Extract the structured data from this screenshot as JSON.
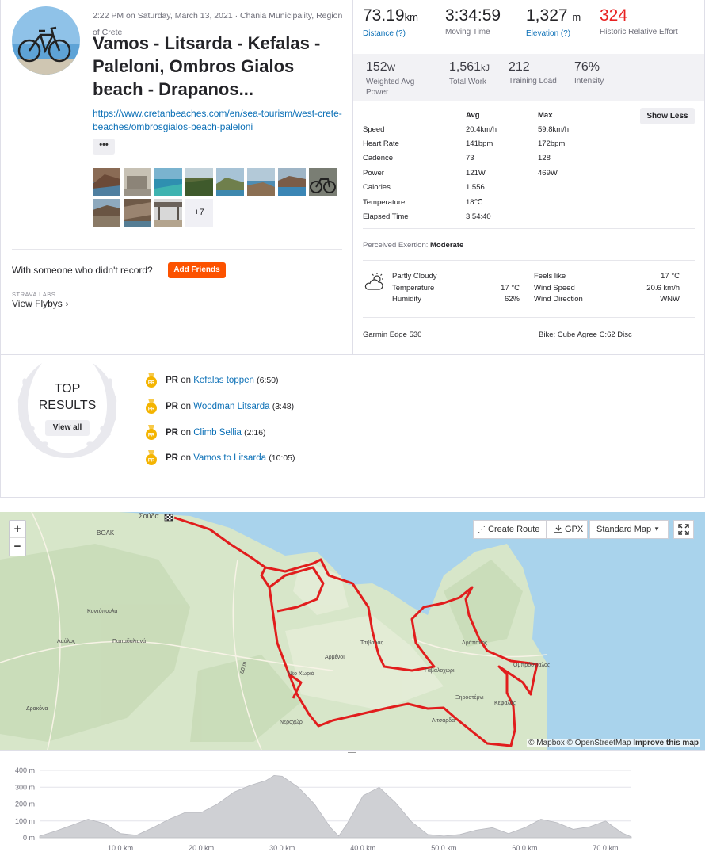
{
  "activity": {
    "meta_date": "2:22 PM on Saturday, March 13, 2021 · Chania Municipality, Region of Crete",
    "title": "Vamos - Litsarda - Kefalas - Paleloni, Ombros Gialos beach - Drapanos...",
    "description_link": "https://www.cretanbeaches.com/en/sea-tourism/west-crete-beaches/ombrosgialos-beach-paleloni",
    "more_label": "•••",
    "photos_more": "+7"
  },
  "friends": {
    "question": "With someone who didn't record?",
    "add_button": "Add Friends",
    "labs_label": "STRAVA LABS",
    "flybys_label": "View Flybys"
  },
  "stats": {
    "distance": {
      "value": "73.19",
      "unit": "km",
      "label": "Distance (?)"
    },
    "moving_time": {
      "value": "3:34:59",
      "label": "Moving Time"
    },
    "elevation": {
      "value": "1,327",
      "unit": "m",
      "label": "Elevation (?)"
    },
    "relative_effort": {
      "value": "324",
      "label": "Historic Relative Effort"
    },
    "weighted_power": {
      "value": "152",
      "unit": "W",
      "label": "Weighted Avg Power"
    },
    "total_work": {
      "value": "1,561",
      "unit": "kJ",
      "label": "Total Work"
    },
    "training_load": {
      "value": "212",
      "label": "Training Load"
    },
    "intensity": {
      "value": "76%",
      "label": "Intensity"
    }
  },
  "metrics": {
    "avg_header": "Avg",
    "max_header": "Max",
    "show_less": "Show Less",
    "rows": [
      {
        "name": "Speed",
        "avg": "20.4km/h",
        "max": "59.8km/h"
      },
      {
        "name": "Heart Rate",
        "avg": "141bpm",
        "max": "172bpm"
      },
      {
        "name": "Cadence",
        "avg": "73",
        "max": "128"
      },
      {
        "name": "Power",
        "avg": "121W",
        "max": "469W"
      },
      {
        "name": "Calories",
        "avg": "1,556",
        "max": ""
      },
      {
        "name": "Temperature",
        "avg": "18℃",
        "max": ""
      },
      {
        "name": "Elapsed Time",
        "avg": "3:54:40",
        "max": ""
      }
    ]
  },
  "exertion": {
    "label": "Perceived Exertion:",
    "value": "Moderate"
  },
  "weather": {
    "condition": "Partly Cloudy",
    "temperature_label": "Temperature",
    "temperature_value": "17 °C",
    "humidity_label": "Humidity",
    "humidity_value": "62%",
    "feels_like_label": "Feels like",
    "feels_like_value": "17 °C",
    "wind_speed_label": "Wind Speed",
    "wind_speed_value": "20.6 km/h",
    "wind_direction_label": "Wind Direction",
    "wind_direction_value": "WNW"
  },
  "gear": {
    "device": "Garmin Edge 530",
    "bike": "Bike: Cube Agree C:62 Disc"
  },
  "top_results": {
    "title_line1": "TOP",
    "title_line2": "RESULTS",
    "view_all": "View all",
    "items": [
      {
        "pr": "PR",
        "on": "on",
        "segment": "Kefalas toppen",
        "time": "(6:50)"
      },
      {
        "pr": "PR",
        "on": "on",
        "segment": "Woodman Litsarda",
        "time": "(3:48)"
      },
      {
        "pr": "PR",
        "on": "on",
        "segment": "Climb Sellia",
        "time": "(2:16)"
      },
      {
        "pr": "PR",
        "on": "on",
        "segment": "Vamos to Litsarda",
        "time": "(10:05)"
      }
    ]
  },
  "map": {
    "create_route": "Create Route",
    "gpx": "GPX",
    "map_type": "Standard Map",
    "attribution_mapbox": "© Mapbox",
    "attribution_osm": "© OpenStreetMap",
    "improve": "Improve this map",
    "zoom_in": "+",
    "zoom_out": "−",
    "places": [
      "Σούδα",
      "BOAK",
      "Κοντόπουλα",
      "Λαύλος",
      "Παπαδολιανά",
      "Αρμένοι",
      "Νέο Χωριό",
      "Τσιβαράς",
      "Γαβαλοχώρι",
      "Δράπανος",
      "Ομπρόσγιαλος",
      "Ξηροστέρνι",
      "Κεφαλάς",
      "Λιτσαρδα",
      "Νεροχώρι",
      "Δρακόνα",
      "60 m"
    ]
  },
  "chart_data": {
    "type": "area",
    "x": [
      0,
      2,
      4,
      6,
      8,
      10,
      12,
      14,
      16,
      18,
      20,
      22,
      24,
      26,
      28,
      29,
      30,
      32,
      34,
      36,
      37,
      38,
      40,
      42,
      44,
      46,
      48,
      50,
      52,
      54,
      56,
      58,
      60,
      62,
      64,
      66,
      68,
      70,
      72,
      73.19
    ],
    "y": [
      10,
      40,
      75,
      110,
      85,
      25,
      15,
      60,
      110,
      150,
      150,
      200,
      270,
      310,
      340,
      370,
      365,
      300,
      200,
      60,
      10,
      80,
      250,
      300,
      210,
      95,
      20,
      10,
      20,
      45,
      60,
      25,
      60,
      110,
      90,
      50,
      65,
      100,
      30,
      5
    ],
    "xlabel": "",
    "ylabel": "",
    "x_ticks": [
      "10.0 km",
      "20.0 km",
      "30.0 km",
      "40.0 km",
      "50.0 km",
      "60.0 km",
      "70.0 km"
    ],
    "x_tick_values": [
      10,
      20,
      30,
      40,
      50,
      60,
      70
    ],
    "y_ticks": [
      "0 m",
      "100 m",
      "200 m",
      "300 m",
      "400 m"
    ],
    "y_tick_values": [
      0,
      100,
      200,
      300,
      400
    ],
    "ylim": [
      0,
      400
    ],
    "xlim": [
      0,
      73.19
    ],
    "color": "#cfd0d4"
  },
  "colors": {
    "brand": "#fc5200",
    "link": "#0a6fb6",
    "route": "#e11d1d",
    "relative_effort": "#e82222",
    "sea": "#a9d3ec",
    "land": "#d7e6c9"
  },
  "icons": [
    "bike-avatar-icon",
    "chevron-right-icon",
    "partly-cloudy-icon",
    "pr-medal-icon",
    "laurel-icon",
    "create-route-icon",
    "download-icon",
    "chevron-down-icon",
    "fullscreen-icon",
    "checkered-flag-icon"
  ]
}
